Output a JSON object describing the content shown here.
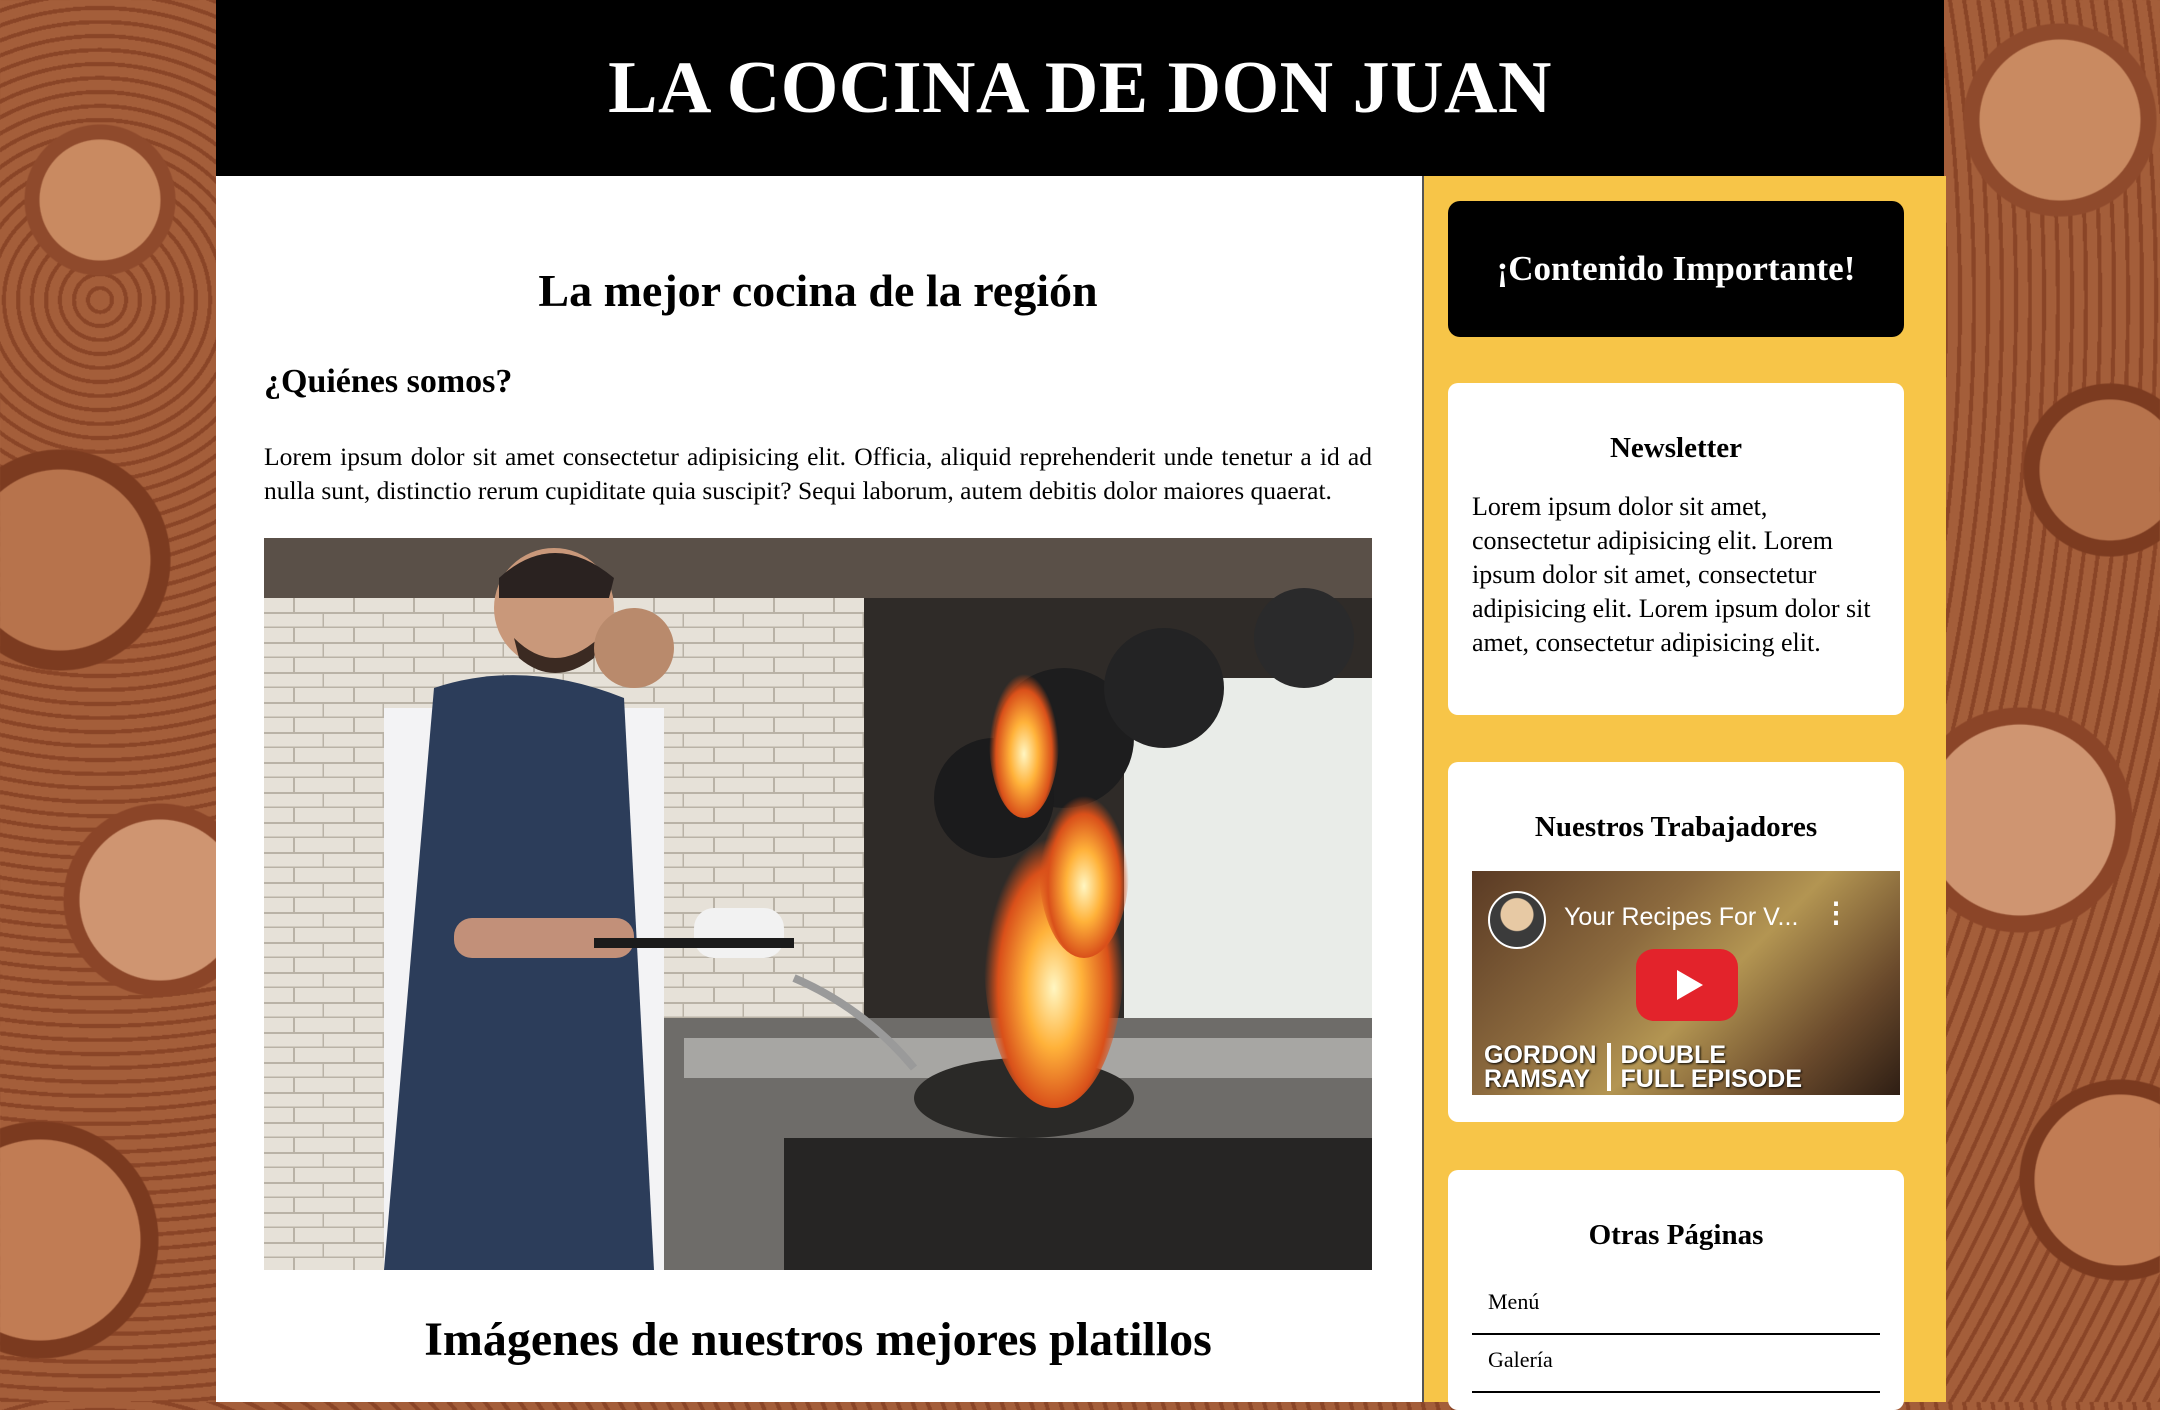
{
  "header": {
    "title": "LA COCINA DE DON JUAN"
  },
  "main": {
    "heading": "La mejor cocina de la región",
    "subheading": "¿Quiénes somos?",
    "paragraph": "Lorem ipsum dolor sit amet consectetur adipisicing elit. Officia, aliquid reprehenderit unde tenetur a id ad nulla sunt, distinctio rerum cupiditate quia suscipit? Sequi laborum, autem debitis dolor maiores quaerat.",
    "gallery_heading": "Imágenes de nuestros mejores platillos"
  },
  "sidebar": {
    "notice": "¡Contenido Importante!",
    "newsletter": {
      "title": "Newsletter",
      "text": "Lorem ipsum dolor sit amet, consectetur adipisicing elit. Lorem ipsum dolor sit amet, consectetur adipisicing elit. Lorem ipsum dolor sit amet, consectetur adipisicing elit."
    },
    "workers": {
      "title": "Nuestros Trabajadores",
      "video": {
        "title": "Your Recipes For V...",
        "brand_left": [
          "GORDON",
          "RAMSAY"
        ],
        "brand_right": [
          "DOUBLE",
          "FULL EPISODE"
        ],
        "menu_glyph": "⋮"
      }
    },
    "other_pages": {
      "title": "Otras Páginas",
      "links": [
        "Menú",
        "Galería"
      ]
    }
  },
  "colors": {
    "header_bg": "#000000",
    "sidebar_bg": "#f7c548",
    "play_button": "#e3232b"
  }
}
